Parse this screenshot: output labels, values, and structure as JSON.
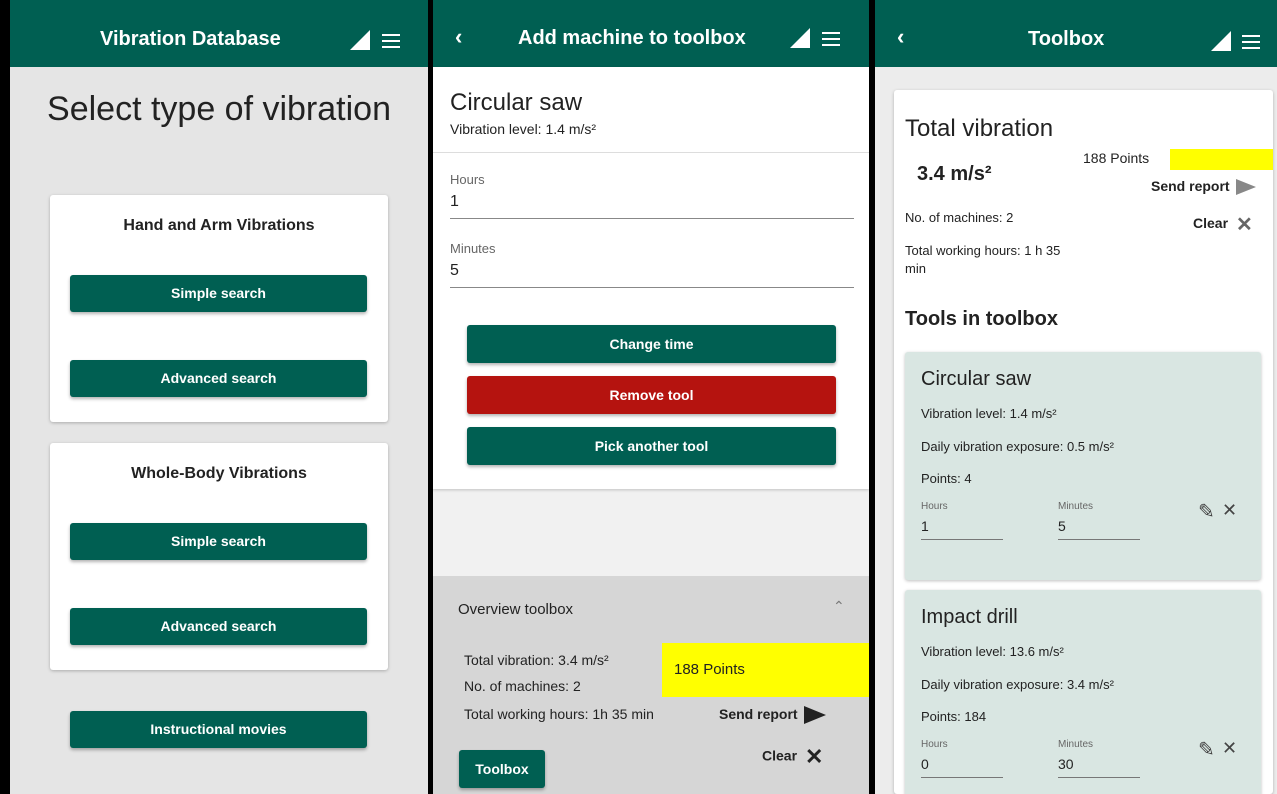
{
  "screen1": {
    "title": "Vibration Database",
    "heading": "Select type of vibration",
    "hand_arm": {
      "title": "Hand and Arm Vibrations",
      "simple": "Simple search",
      "advanced": "Advanced search"
    },
    "whole_body": {
      "title": "Whole-Body Vibrations",
      "simple": "Simple search",
      "advanced": "Advanced search"
    },
    "movies": "Instructional movies"
  },
  "screen2": {
    "back": "‹",
    "title": "Add machine to toolbox",
    "tool_name": "Circular saw",
    "vibration_level": "Vibration level: 1.4 m/s²",
    "hours_label": "Hours",
    "hours_value": "1",
    "minutes_label": "Minutes",
    "minutes_value": "5",
    "change_time": "Change time",
    "remove_tool": "Remove tool",
    "pick_another": "Pick another tool",
    "overview": {
      "title": "Overview toolbox",
      "chevron": "⌃",
      "total_vibration": "Total vibration: 3.4 m/s²",
      "machines": "No. of machines: 2",
      "hours": "Total working hours: 1h 35 min",
      "points": "188 Points",
      "send_report": "Send report",
      "clear": "Clear",
      "toolbox_button": "Toolbox"
    }
  },
  "screen3": {
    "back": "‹",
    "title": "Toolbox",
    "summary": {
      "title": "Total vibration",
      "value": "3.4 m/s²",
      "points": "188 Points",
      "send_report": "Send report",
      "machines": "No. of machines: 2",
      "clear": "Clear",
      "hours": "Total working hours: 1 h 35 min"
    },
    "tools_heading": "Tools in toolbox",
    "tools": [
      {
        "name": "Circular saw",
        "vibration": "Vibration level: 1.4 m/s²",
        "exposure": "Daily vibration exposure: 0.5 m/s²",
        "points": "Points: 4",
        "hours_label": "Hours",
        "hours": "1",
        "minutes_label": "Minutes",
        "minutes": "5"
      },
      {
        "name": "Impact drill",
        "vibration": "Vibration level: 13.6 m/s²",
        "exposure": "Daily vibration exposure: 3.4 m/s²",
        "points": "Points: 184",
        "hours_label": "Hours",
        "hours": "0",
        "minutes_label": "Minutes",
        "minutes": "30"
      }
    ]
  },
  "colors": {
    "primary": "#005f52",
    "danger": "#b5130f",
    "highlight": "#ffff00",
    "tool_card": "#d9e6e2"
  },
  "icons": {
    "signal": "signal-icon",
    "menu": "menu-icon",
    "back": "back-icon",
    "send": "send-icon",
    "close": "close-icon",
    "edit": "pencil-icon"
  }
}
